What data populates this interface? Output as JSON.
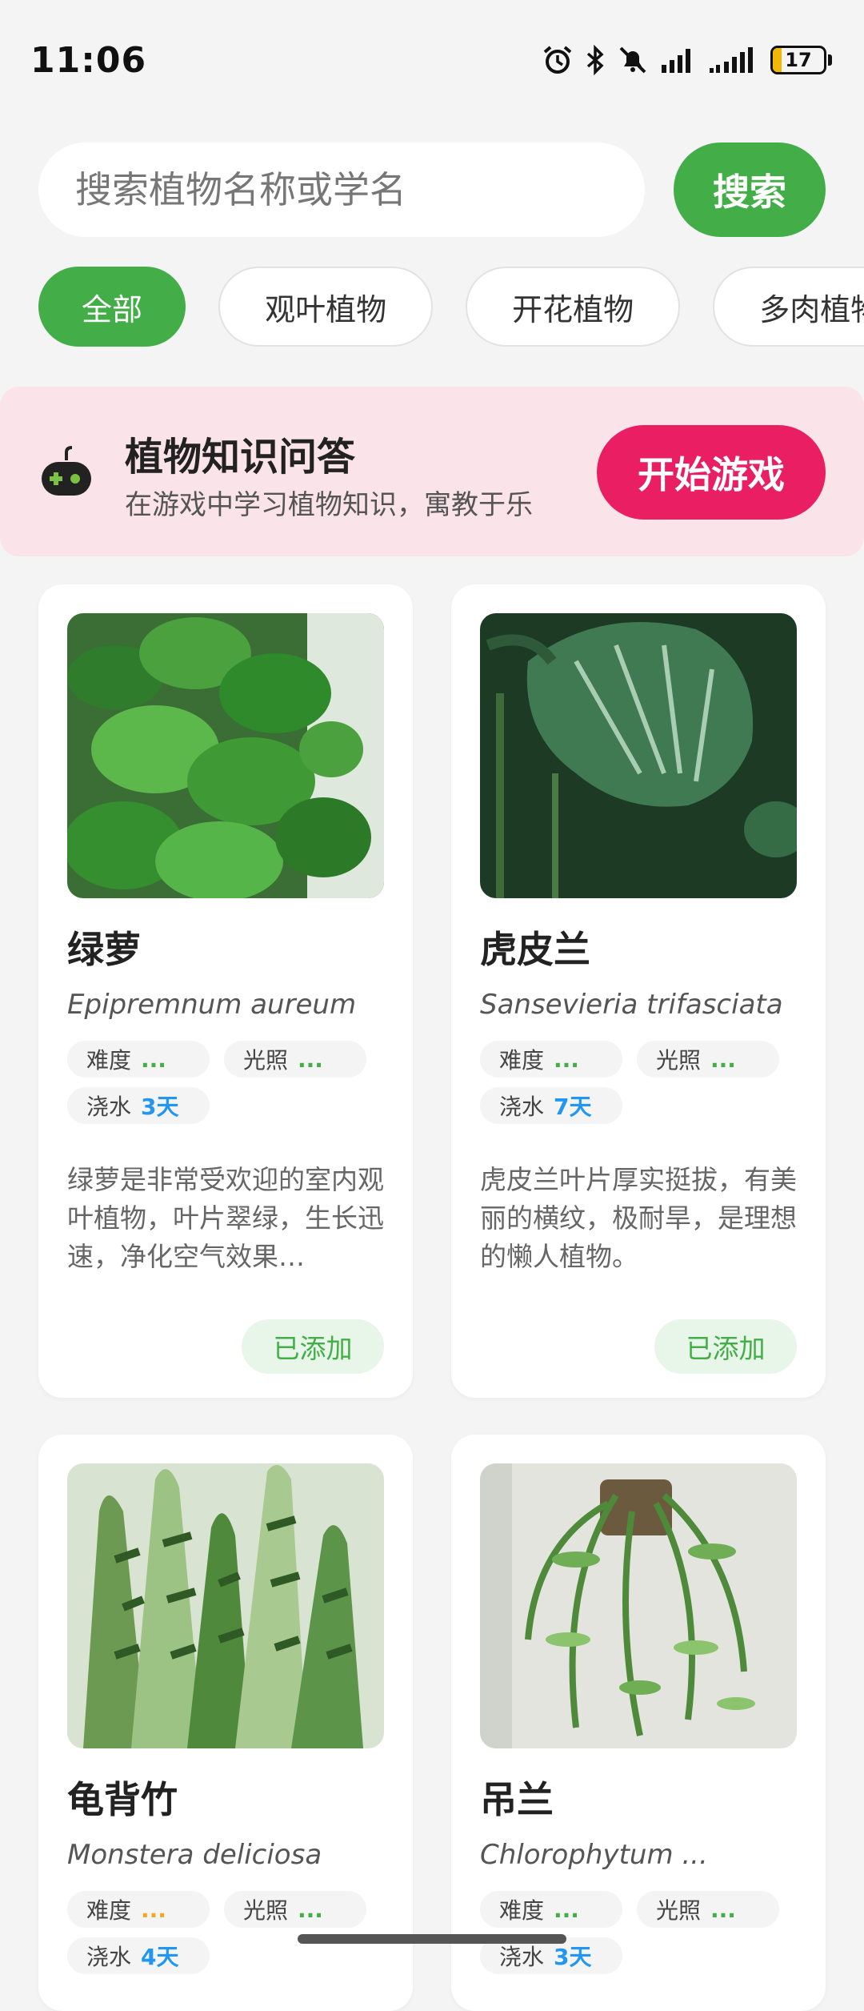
{
  "status_bar": {
    "time": "11:06",
    "battery": "17",
    "battery_level": 0.17,
    "icons": [
      "alarm-icon",
      "bluetooth-icon",
      "mute-icon",
      "signal-icon",
      "signal-icon",
      "battery-icon"
    ]
  },
  "search": {
    "placeholder": "搜索植物名称或学名",
    "button": "搜索"
  },
  "categories": [
    {
      "label": "全部",
      "active": true
    },
    {
      "label": "观叶植物",
      "active": false
    },
    {
      "label": "开花植物",
      "active": false
    },
    {
      "label": "多肉植物",
      "active": false
    }
  ],
  "quiz": {
    "icon": "gamepad-icon",
    "title": "植物知识问答",
    "subtitle": "在游戏中学习植物知识，寓教于乐",
    "button": "开始游戏"
  },
  "plants": [
    {
      "name": "绿萝",
      "latin": "Epipremnum aureum",
      "difficulty_label": "难度",
      "difficulty": "...",
      "difficulty_color": "#43ae47",
      "light_label": "光照",
      "light": "...",
      "water_label": "浇水",
      "water": "3天",
      "description": "绿萝是非常受欢迎的室内观叶植物，叶片翠绿，生长迅速，净化空气效果…",
      "action": "已添加"
    },
    {
      "name": "虎皮兰",
      "latin": "Sansevieria trifasciata",
      "difficulty_label": "难度",
      "difficulty": "...",
      "difficulty_color": "#43ae47",
      "light_label": "光照",
      "light": "...",
      "water_label": "浇水",
      "water": "7天",
      "description": "虎皮兰叶片厚实挺拔，有美丽的横纹，极耐旱，是理想的懒人植物。",
      "action": "已添加"
    },
    {
      "name": "龟背竹",
      "latin": "Monstera deliciosa",
      "difficulty_label": "难度",
      "difficulty": "...",
      "difficulty_color": "#f5a623",
      "light_label": "光照",
      "light": "...",
      "water_label": "浇水",
      "water": "4天"
    },
    {
      "name": "吊兰",
      "latin": "Chlorophytum ...",
      "difficulty_label": "难度",
      "difficulty": "...",
      "difficulty_color": "#43ae47",
      "light_label": "光照",
      "light": "...",
      "water_label": "浇水",
      "water": "3天"
    }
  ],
  "colors": {
    "primary": "#43ae47",
    "accent": "#e91e63",
    "banner_bg": "#fbe3ea",
    "water": "#2196f3"
  }
}
